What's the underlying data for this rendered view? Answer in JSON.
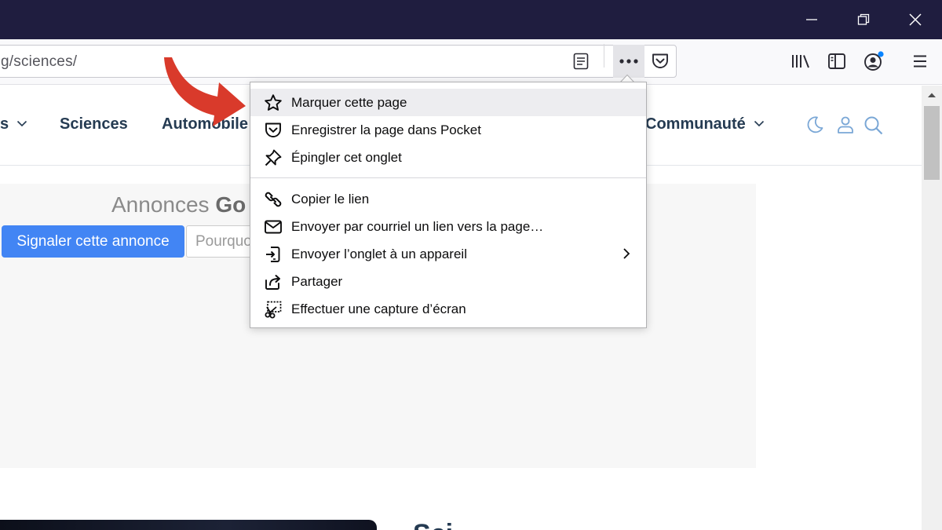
{
  "browser": {
    "url_text": "g/sciences/",
    "window_controls": [
      "minimize",
      "restore",
      "close"
    ],
    "toolbar_icons": [
      "reader-view-icon",
      "more-actions-icon",
      "pocket-icon",
      "library-icon",
      "sidebar-icon",
      "account-icon",
      "menu-icon"
    ],
    "notification_dot_color": "#0a84ff"
  },
  "site": {
    "nav": {
      "partial_item": "s",
      "items": [
        "Sciences",
        "Automobile",
        "Communauté"
      ]
    },
    "ad": {
      "title_light": "Annonces ",
      "title_brand": "Go",
      "report_button": "Signaler cette annonce",
      "reason_placeholder": "Pourquo"
    },
    "partial_heading": "Sci"
  },
  "page_actions_menu": {
    "items": [
      {
        "icon": "star-icon",
        "label": "Marquer cette page",
        "highlighted": true
      },
      {
        "icon": "pocket-icon",
        "label": "Enregistrer la page dans Pocket"
      },
      {
        "icon": "pin-icon",
        "label": "Épingler cet onglet"
      },
      {
        "icon": "link-icon",
        "label": "Copier le lien"
      },
      {
        "icon": "mail-icon",
        "label": "Envoyer par courriel un lien vers la page…"
      },
      {
        "icon": "send-to-device-icon",
        "label": "Envoyer l’onglet à un appareil",
        "submenu": true
      },
      {
        "icon": "share-icon",
        "label": "Partager"
      },
      {
        "icon": "screenshot-icon",
        "label": "Effectuer une capture d’écran"
      }
    ]
  },
  "colors": {
    "titlebar": "#1f1d3f",
    "report_button": "#4285f4",
    "nav_text": "#253b52",
    "nav_icons": "#7aa7d6",
    "arrow": "#d93a2b"
  }
}
